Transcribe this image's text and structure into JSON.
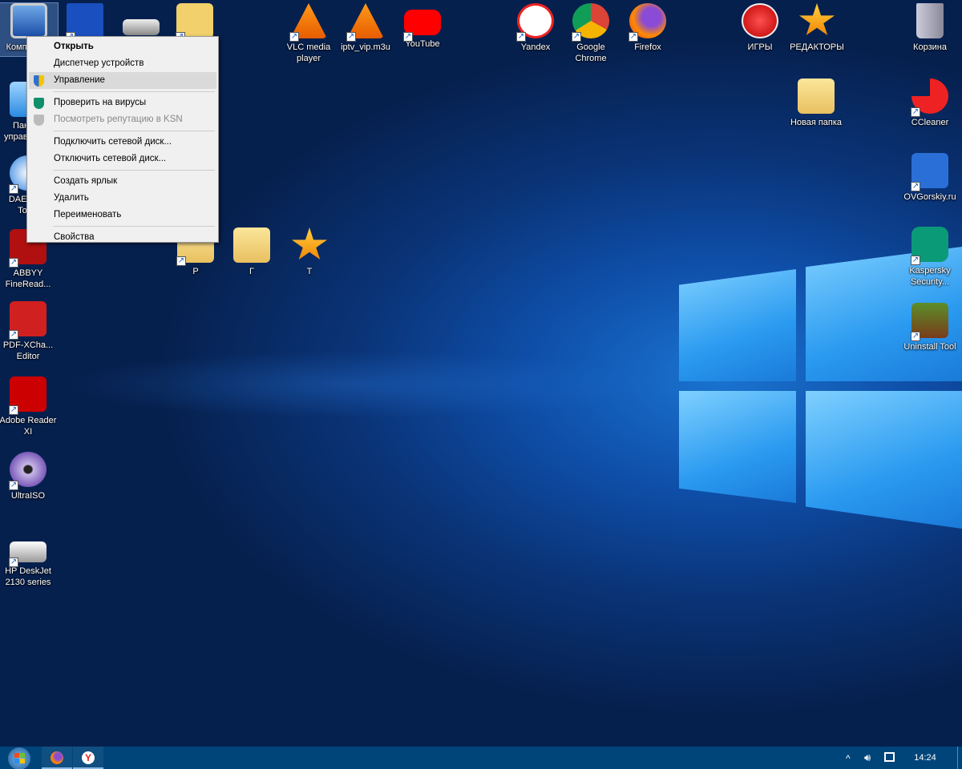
{
  "desktop_icons": {
    "computer": {
      "label": "Компьютер",
      "icon": "computer-icon"
    },
    "floppy": {
      "label": "",
      "icon": "floppy-icon"
    },
    "drive": {
      "label": "",
      "icon": "drive-icon"
    },
    "downloads": {
      "label": "",
      "icon": "folder-download-icon"
    },
    "vlc": {
      "label": "VLC media player",
      "icon": "vlc-icon"
    },
    "iptv": {
      "label": "iptv_vip.m3u",
      "icon": "vlc-icon"
    },
    "youtube": {
      "label": "YouTube",
      "icon": "youtube-icon"
    },
    "yandex": {
      "label": "Yandex",
      "icon": "yandex-icon"
    },
    "chrome": {
      "label": "Google Chrome",
      "icon": "chrome-icon"
    },
    "firefox": {
      "label": "Firefox",
      "icon": "firefox-icon"
    },
    "games": {
      "label": "ИГРЫ",
      "icon": "red-x-icon"
    },
    "editors": {
      "label": "РЕДАКТОРЫ",
      "icon": "star-icon"
    },
    "recycle": {
      "label": "Корзина",
      "icon": "recycle-bin-icon"
    },
    "new_folder": {
      "label": "Новая папка",
      "icon": "folder-icon"
    },
    "ccleaner": {
      "label": "CCleaner",
      "icon": "ccleaner-icon"
    },
    "ovgorskiy": {
      "label": "OVGorskiy.ru",
      "icon": "ovg-icon"
    },
    "kaspersky": {
      "label": "Kaspersky Security...",
      "icon": "kaspersky-icon"
    },
    "uninstall": {
      "label": "Uninstall Tool",
      "icon": "uninstall-tool-icon"
    },
    "control_panel": {
      "label": "Панель управления",
      "icon": "control-panel-icon"
    },
    "daemon": {
      "label": "DAEMON Tools",
      "icon": "daemon-tools-icon"
    },
    "abbyy": {
      "label": "ABBYY FineRead...",
      "icon": "abbyy-icon"
    },
    "pdfx": {
      "label": "PDF-XCha... Editor",
      "icon": "pdf-icon"
    },
    "adobe": {
      "label": "Adobe Reader XI",
      "icon": "adobe-reader-icon"
    },
    "ultraiso": {
      "label": "UltraISO",
      "icon": "disc-icon"
    },
    "hp": {
      "label": "HP DeskJet 2130 series",
      "icon": "printer-icon"
    },
    "p": {
      "label": "Р",
      "icon": "folder-icon"
    },
    "g": {
      "label": "Г",
      "icon": "folder-icon"
    },
    "t": {
      "label": "Т",
      "icon": "star-icon"
    }
  },
  "context_menu": {
    "items": [
      {
        "label": "Открыть",
        "bold": true
      },
      {
        "label": "Диспетчер устройств"
      },
      {
        "label": "Управление",
        "icon": "uac-shield-icon",
        "highlighted": true
      },
      {
        "label": "Проверить на вирусы",
        "icon": "kaspersky-shield-icon"
      },
      {
        "label": "Посмотреть репутацию в KSN",
        "icon": "ksn-shield-icon",
        "disabled": true
      },
      {
        "label": "Подключить сетевой диск..."
      },
      {
        "label": "Отключить сетевой диск..."
      },
      {
        "label": "Создать ярлык"
      },
      {
        "label": "Удалить"
      },
      {
        "label": "Переименовать"
      },
      {
        "label": "Свойства"
      }
    ]
  },
  "taskbar": {
    "clock": "14:24",
    "pinned": [
      "firefox-icon",
      "yandex-icon"
    ]
  },
  "colors": {
    "taskbar": "#00457a",
    "menu_bg": "#f0f0f0",
    "highlight": "#dadada"
  }
}
